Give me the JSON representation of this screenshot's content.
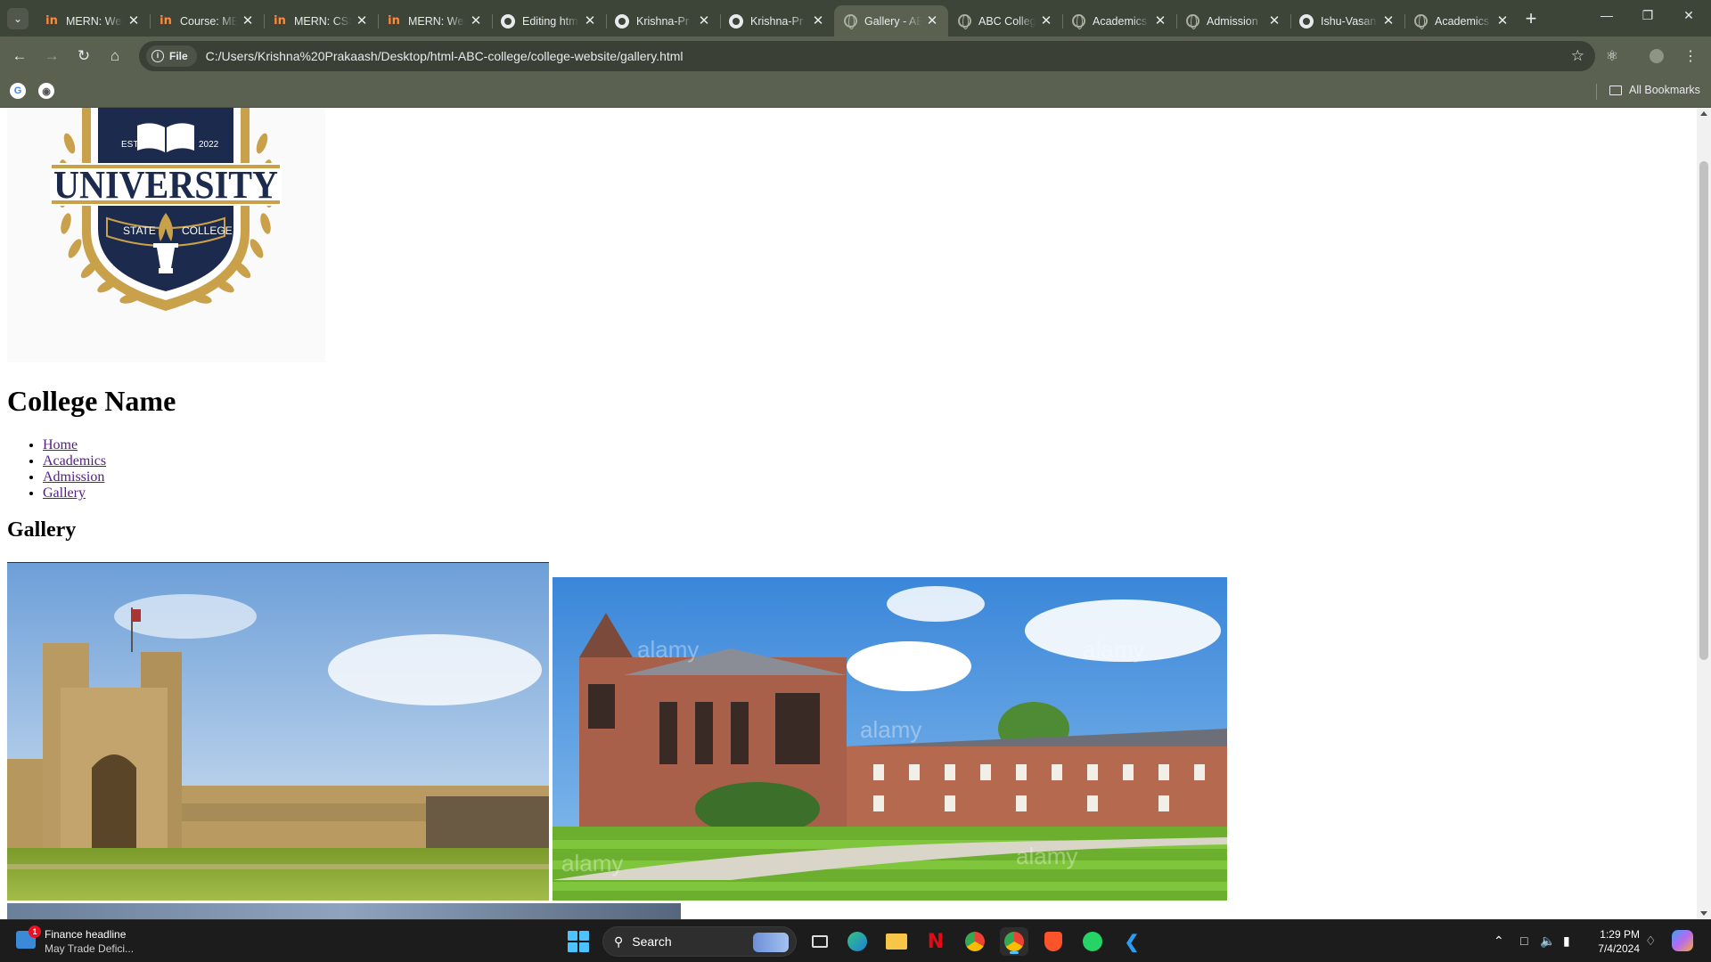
{
  "browser": {
    "tabs": [
      {
        "title": "MERN: Web",
        "favicon": "internshala-icon",
        "active": false
      },
      {
        "title": "Course: MERN",
        "favicon": "internshala-icon",
        "active": false
      },
      {
        "title": "MERN: CSS",
        "favicon": "internshala-icon",
        "active": false
      },
      {
        "title": "MERN: Web",
        "favicon": "internshala-icon",
        "active": false
      },
      {
        "title": "Editing html",
        "favicon": "github-icon",
        "active": false
      },
      {
        "title": "Krishna-Pr",
        "favicon": "github-icon",
        "active": false
      },
      {
        "title": "Krishna-Pr",
        "favicon": "github-icon",
        "active": false
      },
      {
        "title": "Gallery - ABC",
        "favicon": "globe-icon",
        "active": true
      },
      {
        "title": "ABC College",
        "favicon": "globe-icon",
        "active": false
      },
      {
        "title": "Academics",
        "favicon": "globe-icon",
        "active": false
      },
      {
        "title": "Admission",
        "favicon": "globe-icon",
        "active": false
      },
      {
        "title": "Ishu-Vasan",
        "favicon": "github-icon",
        "active": false
      },
      {
        "title": "Academics",
        "favicon": "globe-icon",
        "active": false
      }
    ],
    "site_chip": "File",
    "url": "C:/Users/Krishna%20Prakaash/Desktop/html-ABC-college/college-website/gallery.html",
    "all_bookmarks": "All Bookmarks"
  },
  "page": {
    "heading": "College Name",
    "nav": [
      "Home",
      "Academics",
      "Admission",
      "Gallery"
    ],
    "section_heading": "Gallery",
    "logo": {
      "main_text": "UNIVERSITY",
      "estd": "ESTD.",
      "year": "2022",
      "ribbon_left": "STATE",
      "ribbon_right": "COLLEGE"
    },
    "watermark": "alamy"
  },
  "taskbar": {
    "news_title": "Finance headline",
    "news_subtitle": "May Trade Defici...",
    "news_badge": "1",
    "search_label": "Search",
    "time": "1:29 PM",
    "date": "7/4/2024"
  },
  "colors": {
    "tab_strip": "#3d4438",
    "toolbar": "#5a6150",
    "logo_navy": "#1c2a4e",
    "logo_gold": "#c9a14a",
    "link": "#551a8b"
  }
}
